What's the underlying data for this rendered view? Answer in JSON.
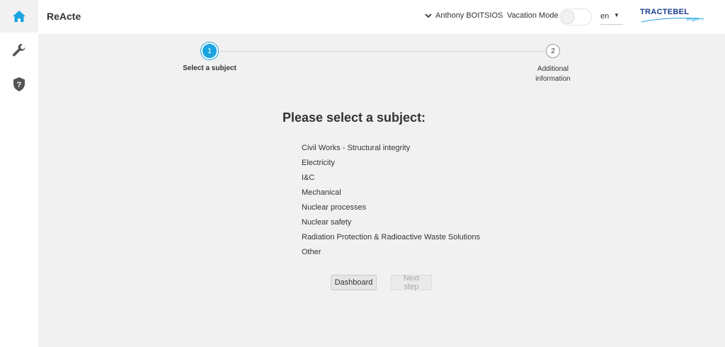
{
  "app": {
    "title": "ReActe"
  },
  "sidebar": {
    "items": [
      {
        "icon": "home-icon",
        "active": true
      },
      {
        "icon": "wrench-icon",
        "active": false
      },
      {
        "icon": "help-icon",
        "active": false
      }
    ]
  },
  "header": {
    "user_name": "Anthony BOITSIOS",
    "vacation_label": "Vacation Mode",
    "vacation_on": false,
    "language": "en",
    "logo": {
      "brand": "TRACTEBEL",
      "sub": "engie"
    }
  },
  "stepper": {
    "steps": [
      {
        "number": "1",
        "label": "Select a subject",
        "active": true
      },
      {
        "number": "2",
        "label_line1": "Additional",
        "label_line2": "information",
        "active": false
      }
    ]
  },
  "content": {
    "heading": "Please select a subject:",
    "subjects": [
      "Civil Works - Structural integrity",
      "Electricity",
      "I&C",
      "Mechanical",
      "Nuclear processes",
      "Nuclear safety",
      "Radiation Protection & Radioactive Waste Solutions",
      "Other"
    ]
  },
  "buttons": {
    "dashboard": "Dashboard",
    "next": "Next step"
  },
  "colors": {
    "accent": "#1aa3e0",
    "main_bg": "#f1f1f1",
    "brand": "#1a3e8c"
  }
}
